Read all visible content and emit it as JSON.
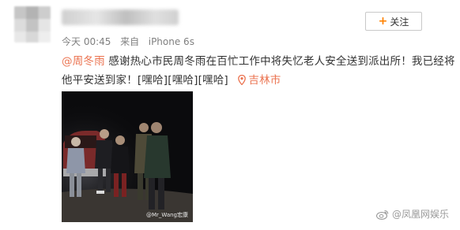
{
  "post": {
    "time": "今天 00:45",
    "from_label": "来自",
    "device": "iPhone 6s",
    "follow_label": "关注",
    "mention": "@周冬雨",
    "text": " 感谢热心市民周冬雨在百忙工作中将失忆老人安全送到派出所！我已经将他平安送到家！[嘿哈][嘿哈][嘿哈]",
    "location": "吉林市",
    "photo_watermark": "@Mr_Wang宏康"
  },
  "source_watermark": "@凤凰网娱乐",
  "colors": {
    "link": "#eb7350",
    "accent": "#ff8200",
    "meta": "#808080"
  },
  "icons": {
    "follow": "plus-icon",
    "location": "location-pin-icon",
    "brand": "weibo-logo-icon"
  }
}
